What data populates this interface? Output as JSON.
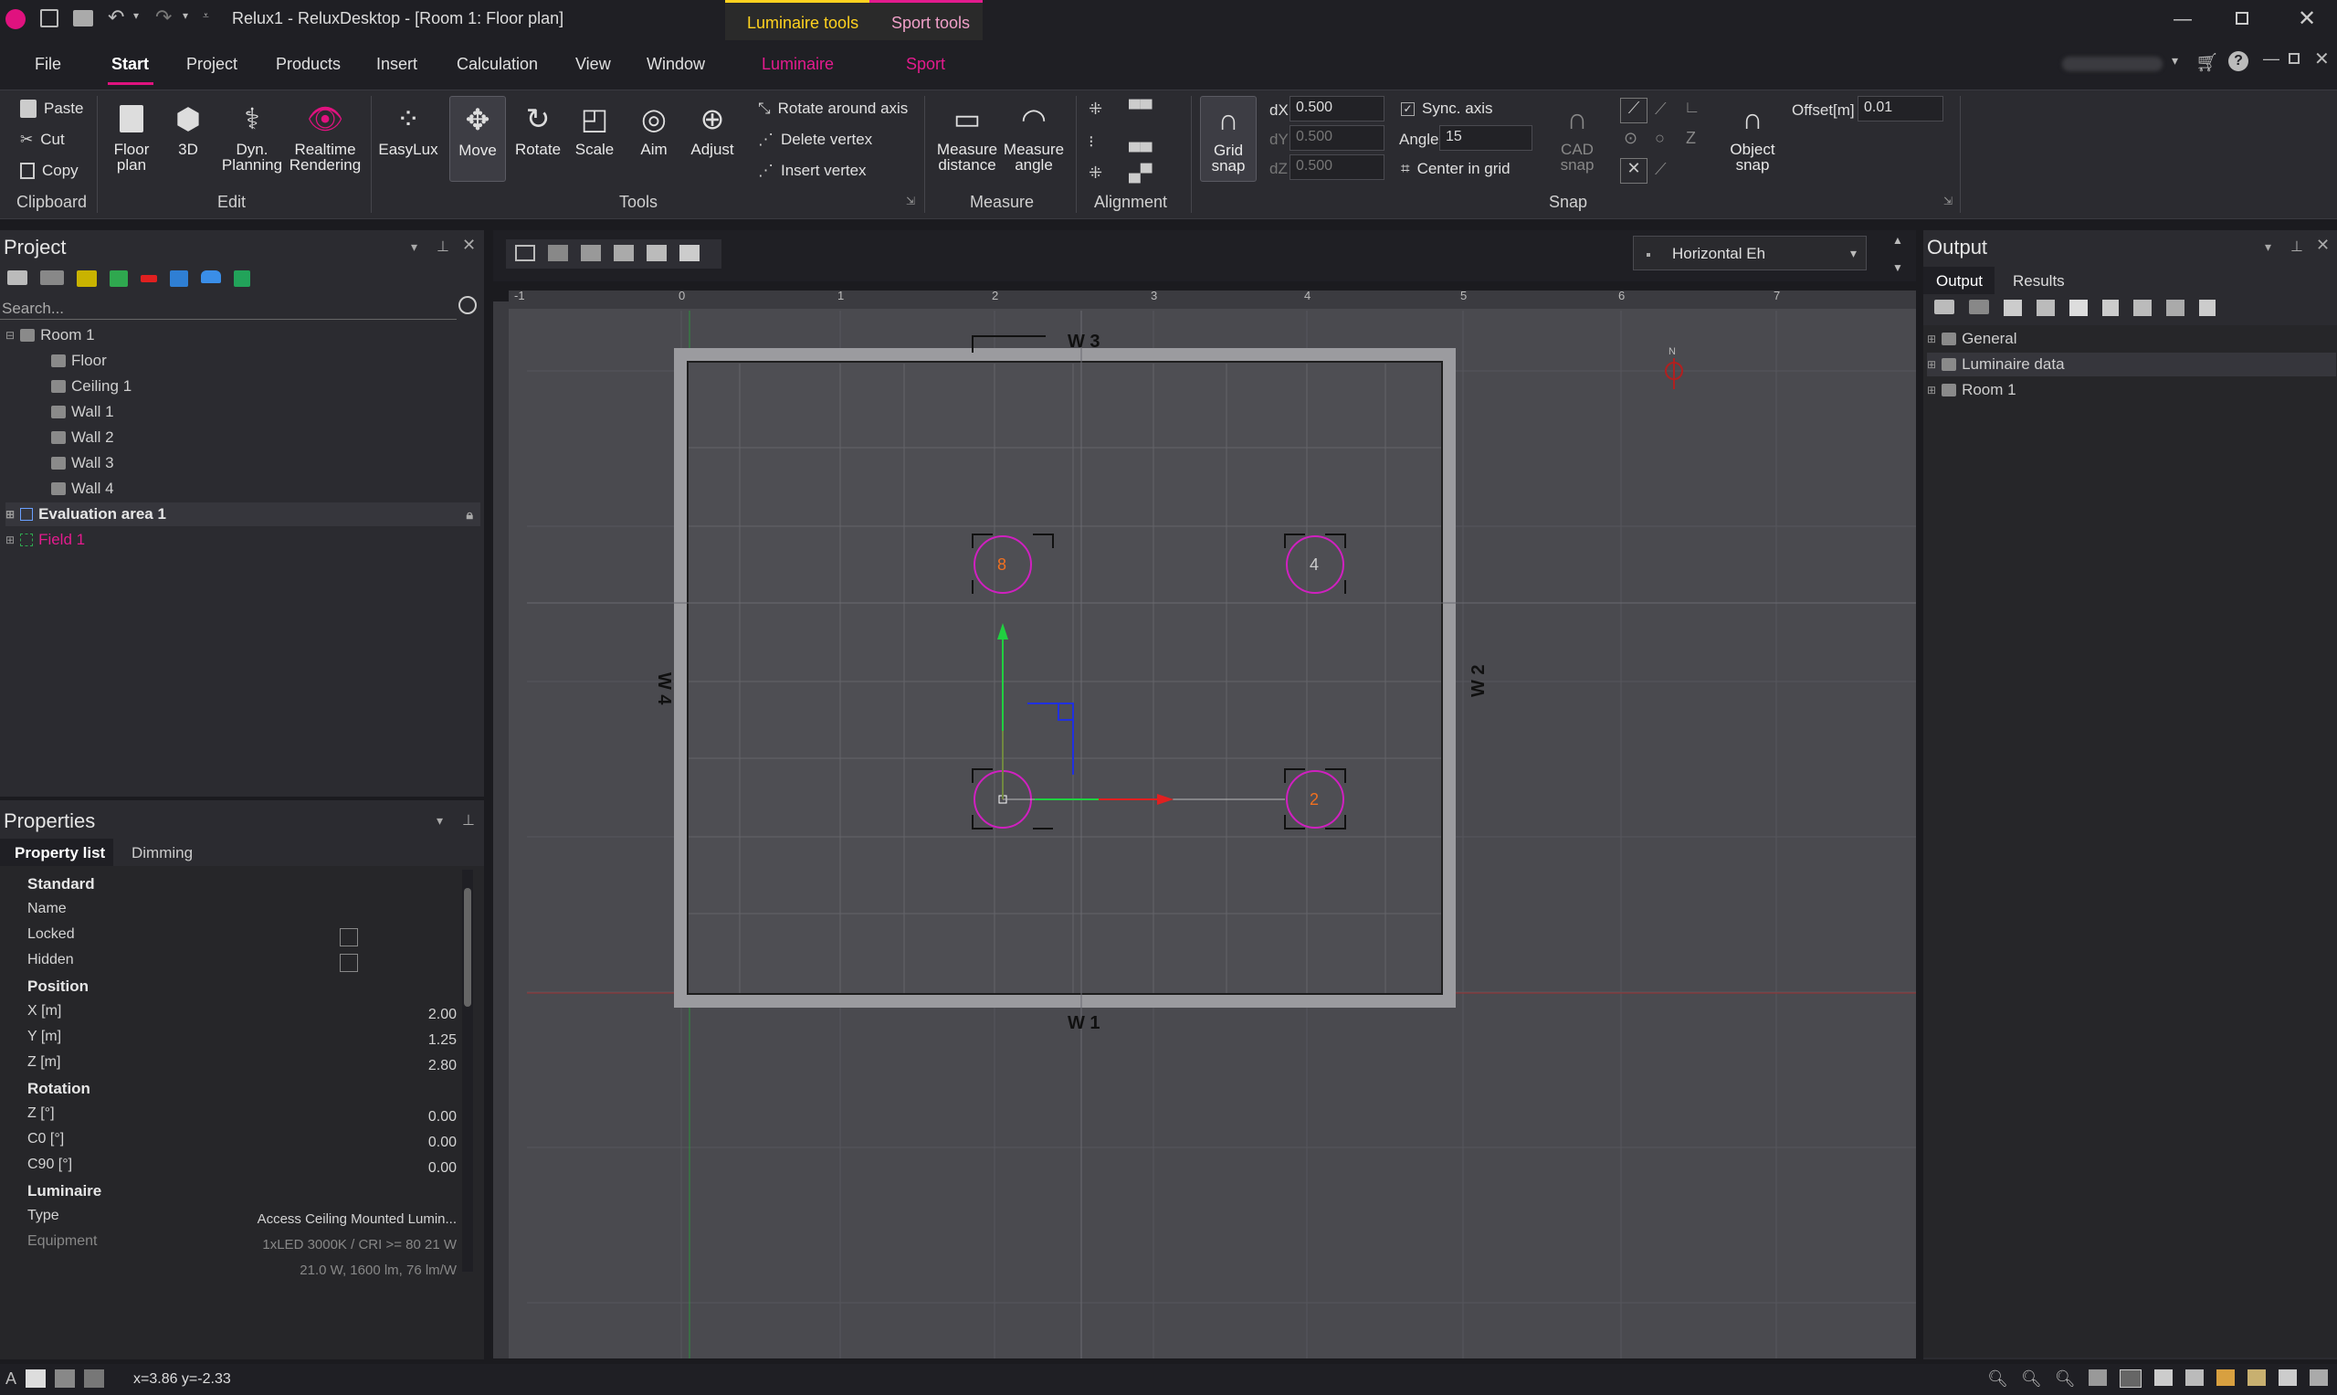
{
  "window": {
    "title": "Relux1 - ReluxDesktop - [Room 1: Floor plan]",
    "context_tab_luminaire": "Luminaire tools",
    "context_tab_sport": "Sport tools"
  },
  "menu": [
    "File",
    "Start",
    "Project",
    "Products",
    "Insert",
    "Calculation",
    "View",
    "Window",
    "Luminaire",
    "Sport"
  ],
  "ribbon": {
    "clipboard": {
      "paste": "Paste",
      "cut": "Cut",
      "copy": "Copy",
      "label": "Clipboard"
    },
    "edit": {
      "floor_plan": "Floor plan",
      "threeD": "3D",
      "dyn_planning": "Dyn. Planning",
      "realtime": "Realtime Rendering",
      "label": "Edit"
    },
    "tools": {
      "easylux": "EasyLux",
      "move": "Move",
      "rotate": "Rotate",
      "scale": "Scale",
      "aim": "Aim",
      "adjust": "Adjust",
      "rotate_axis": "Rotate around axis",
      "delete_vertex": "Delete vertex",
      "insert_vertex": "Insert vertex",
      "label": "Tools"
    },
    "measure": {
      "distance": "Measure distance",
      "angle": "Measure angle",
      "label": "Measure"
    },
    "alignment": {
      "label": "Alignment"
    },
    "snap": {
      "grid_snap": "Grid snap",
      "dx_label": "dX",
      "dx": "0.500",
      "dy_label": "dY",
      "dy": "0.500",
      "dz_label": "dZ",
      "dz": "0.500",
      "sync_axis": "Sync. axis",
      "angle_label": "Angle",
      "angle": "15",
      "center_grid": "Center in grid",
      "cad_snap": "CAD snap",
      "object_snap": "Object snap",
      "offset_label": "Offset[m]",
      "offset": "0.01",
      "label": "Snap"
    }
  },
  "project": {
    "title": "Project",
    "search_placeholder": "Search...",
    "tree": [
      {
        "label": "Room 1"
      },
      {
        "label": "Floor"
      },
      {
        "label": "Ceiling 1"
      },
      {
        "label": "Wall 1"
      },
      {
        "label": "Wall 2"
      },
      {
        "label": "Wall 3"
      },
      {
        "label": "Wall 4"
      },
      {
        "label": "Evaluation area 1"
      },
      {
        "label": "Field 1"
      }
    ]
  },
  "properties": {
    "title": "Properties",
    "tab_list": "Property list",
    "tab_dimming": "Dimming",
    "standard": "Standard",
    "name": "Name",
    "locked": "Locked",
    "hidden": "Hidden",
    "position": "Position",
    "x_label": "X [m]",
    "x": "2.00",
    "y_label": "Y [m]",
    "y": "1.25",
    "z_label": "Z [m]",
    "z": "2.80",
    "rotation": "Rotation",
    "rz_label": "Z [°]",
    "rz": "0.00",
    "c0_label": "C0 [°]",
    "c0": "0.00",
    "c90_label": "C90 [°]",
    "c90": "0.00",
    "luminaire": "Luminaire",
    "type_label": "Type",
    "type": "Access Ceiling Mounted Lumin...",
    "equipment_label": "Equipment",
    "equipment1": "1xLED 3000K / CRI >= 80 21 W",
    "equipment2": "21.0 W, 1600 lm, 76 lm/W"
  },
  "view": {
    "dropdown": "Horizontal Eh",
    "ruler_top": [
      "-1",
      "0",
      "1",
      "2",
      "3",
      "4",
      "5",
      "6",
      "7"
    ],
    "walls": {
      "w1": "W 1",
      "w2": "W 2",
      "w3": "W 3",
      "w4": "W 4"
    },
    "north": "N",
    "luminaires": [
      "8",
      "4",
      "",
      "2"
    ]
  },
  "output": {
    "title": "Output",
    "tab_output": "Output",
    "tab_results": "Results",
    "items": [
      "General",
      "Luminaire data",
      "Room 1"
    ]
  },
  "status": {
    "coords": "x=3.86 y=-2.33"
  },
  "colors": {
    "accent": "#e0127f",
    "luminaire_tab": "#e31b8d",
    "context_yellow": "#ffd21f"
  }
}
